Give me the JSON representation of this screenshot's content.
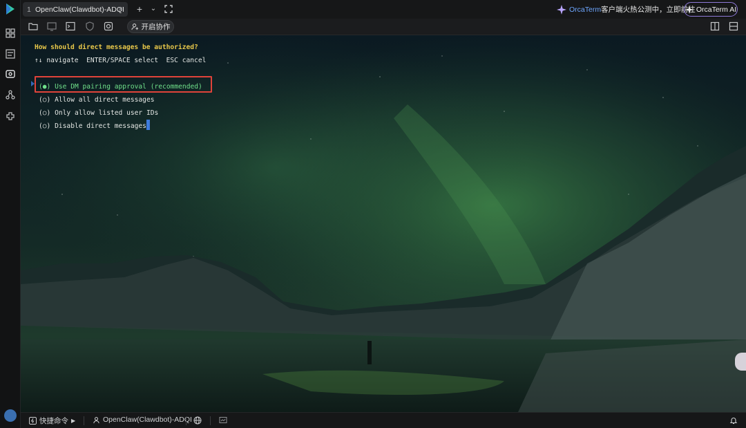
{
  "tab": {
    "number": "1",
    "title": "OpenClaw(Clawdbot)-ADQI",
    "close": "×"
  },
  "header": {
    "promo_brand": "OrcaTerm",
    "promo_text": "客户端火热公测中，立即前往",
    "ai_button": "OrcaTerm AI"
  },
  "toolbar": {
    "collab_label": "开启协作"
  },
  "terminal": {
    "question": "How should direct messages be authorized?",
    "help": "↑↓ navigate  ENTER/SPACE select  ESC cancel",
    "options": [
      "(●) Use DM pairing approval (recommended)",
      "(○) Allow all direct messages",
      "(○) Only allow listed user IDs",
      "(○) Disable direct messages"
    ],
    "selected_index": 0
  },
  "statusbar": {
    "quick_commands": "快捷命令",
    "session": "OpenClaw(Clawdbot)-ADQI"
  },
  "colors": {
    "question": "#e9c84a",
    "selected_option": "#6fe08a",
    "highlight_box": "#e0433a",
    "cursor": "#3d7bdc",
    "ai_border": "#8f7ad8"
  }
}
